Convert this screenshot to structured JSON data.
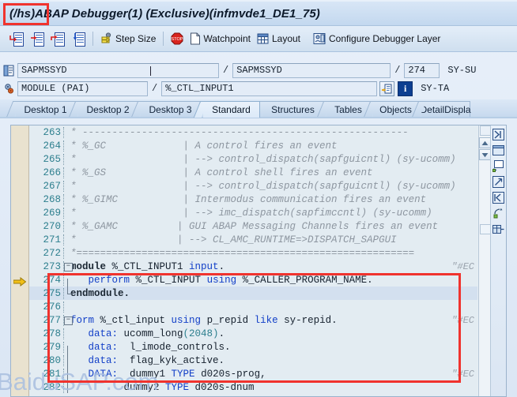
{
  "window": {
    "title": "(/hs)ABAP Debugger(1)  (Exclusive)(infmvde1_DE1_75)",
    "command_prefix": "(/hs)"
  },
  "toolbar": {
    "icons": [
      {
        "name": "step-into-icon",
        "tooltip": "Single Step"
      },
      {
        "name": "step-over-icon",
        "tooltip": "Execute"
      },
      {
        "name": "step-return-icon",
        "tooltip": "Return"
      },
      {
        "name": "continue-icon",
        "tooltip": "Continue"
      }
    ],
    "buttons": [
      {
        "name": "step-size-button",
        "label": "Step Size",
        "icon": "step-size-icon"
      },
      {
        "name": "watchpoint-button",
        "label": "Watchpoint",
        "icon": "watchpoint-icon"
      },
      {
        "name": "layout-button",
        "label": "Layout",
        "icon": "layout-icon"
      },
      {
        "name": "configure-debugger-layer-button",
        "label": "Configure Debugger Layer",
        "icon": "configure-icon"
      }
    ]
  },
  "fields": {
    "row1": {
      "icon": "program-icon",
      "main_program": "SAPMSSYD",
      "separator": "/",
      "include_program": "SAPMSSYD",
      "separator2": "/",
      "line_number": "274",
      "sy_field": "SY-SU"
    },
    "row2": {
      "icon": "event-icon",
      "event_type": "MODULE (PAI)",
      "separator": "/",
      "event_name": "%_CTL_INPUT1",
      "goto_button": "goto-icon",
      "info_button": "i",
      "sy_field": "SY-TA"
    }
  },
  "tabs": [
    {
      "label": "Desktop 1",
      "selected": false
    },
    {
      "label": "Desktop 2",
      "selected": false
    },
    {
      "label": "Desktop 3",
      "selected": false
    },
    {
      "label": "Standard",
      "selected": true
    },
    {
      "label": "Structures",
      "selected": false
    },
    {
      "label": "Tables",
      "selected": false
    },
    {
      "label": "Objects",
      "selected": false
    },
    {
      "label": "DetailDispla",
      "selected": false
    }
  ],
  "editor": {
    "current_line": 274,
    "lines": [
      {
        "n": "263",
        "segs": [
          {
            "t": "* -------------------------------------------------------",
            "c": "cmt"
          }
        ],
        "fold": "",
        "ec": ""
      },
      {
        "n": "264",
        "segs": [
          {
            "t": "* %_GC             | A control fires an event",
            "c": "cmt"
          }
        ],
        "fold": "",
        "ec": ""
      },
      {
        "n": "265",
        "segs": [
          {
            "t": "*                  | --> control_dispatch(sapfguicntl) (sy-ucomm)",
            "c": "cmt"
          }
        ],
        "fold": "",
        "ec": ""
      },
      {
        "n": "266",
        "segs": [
          {
            "t": "* %_GS             | A control shell fires an event",
            "c": "cmt"
          }
        ],
        "fold": "",
        "ec": ""
      },
      {
        "n": "267",
        "segs": [
          {
            "t": "*                  | --> control_dispatch(sapfguicntl) (sy-ucomm)",
            "c": "cmt"
          }
        ],
        "fold": "",
        "ec": ""
      },
      {
        "n": "268",
        "segs": [
          {
            "t": "* %_GIMC           | Intermodus communication fires an event",
            "c": "cmt"
          }
        ],
        "fold": "",
        "ec": ""
      },
      {
        "n": "269",
        "segs": [
          {
            "t": "*                  | --> imc_dispatch(sapfimccntl) (sy-ucomm)",
            "c": "cmt"
          }
        ],
        "fold": "",
        "ec": ""
      },
      {
        "n": "270",
        "segs": [
          {
            "t": "* %_GAMC          | GUI ABAP Messaging Channels fires an event",
            "c": "cmt"
          }
        ],
        "fold": "",
        "ec": ""
      },
      {
        "n": "271",
        "segs": [
          {
            "t": "*                 | --> CL_AMC_RUNTIME=>DISPATCH_SAPGUI",
            "c": "cmt"
          }
        ],
        "fold": "",
        "ec": ""
      },
      {
        "n": "272",
        "segs": [
          {
            "t": "*=========================================================",
            "c": "cmt"
          }
        ],
        "fold": "",
        "ec": ""
      },
      {
        "n": "273",
        "segs": [
          {
            "t": "module ",
            "c": "bold"
          },
          {
            "t": "%_CTL_INPUT1 ",
            "c": "plain"
          },
          {
            "t": "input",
            "c": "kw"
          },
          {
            "t": ".",
            "c": "plain"
          }
        ],
        "fold": "minus",
        "ec": "\"#EC"
      },
      {
        "n": "274",
        "segs": [
          {
            "t": "   ",
            "c": "plain"
          },
          {
            "t": "perform",
            "c": "kw"
          },
          {
            "t": " %_CTL_INPUT ",
            "c": "plain"
          },
          {
            "t": "using",
            "c": "kw"
          },
          {
            "t": " %_CALLER_PROGRAM_NAME.",
            "c": "plain"
          }
        ],
        "fold": "",
        "ec": ""
      },
      {
        "n": "275",
        "segs": [
          {
            "t": "endmodule.",
            "c": "bold"
          }
        ],
        "fold": "end",
        "ec": "",
        "hl": true
      },
      {
        "n": "276",
        "segs": [
          {
            "t": "",
            "c": "plain"
          }
        ],
        "fold": "",
        "ec": ""
      },
      {
        "n": "277",
        "segs": [
          {
            "t": "form",
            "c": "kw"
          },
          {
            "t": " %_ctl_input ",
            "c": "plain"
          },
          {
            "t": "using",
            "c": "kw"
          },
          {
            "t": " p_repid ",
            "c": "plain"
          },
          {
            "t": "like",
            "c": "kw"
          },
          {
            "t": " sy-repid.",
            "c": "plain"
          }
        ],
        "fold": "minus",
        "ec": "\"#EC"
      },
      {
        "n": "278",
        "segs": [
          {
            "t": "   ",
            "c": "plain"
          },
          {
            "t": "data:",
            "c": "kw"
          },
          {
            "t": " ucomm_long",
            "c": "plain"
          },
          {
            "t": "(2048)",
            "c": "num"
          },
          {
            "t": ".",
            "c": "plain"
          }
        ],
        "fold": "",
        "ec": ""
      },
      {
        "n": "279",
        "segs": [
          {
            "t": "   ",
            "c": "plain"
          },
          {
            "t": "data:",
            "c": "kw"
          },
          {
            "t": "  l_imode_controls.",
            "c": "plain"
          }
        ],
        "fold": "",
        "ec": ""
      },
      {
        "n": "280",
        "segs": [
          {
            "t": "   ",
            "c": "plain"
          },
          {
            "t": "data:",
            "c": "kw"
          },
          {
            "t": "  flag_kyk_active.",
            "c": "plain"
          }
        ],
        "fold": "",
        "ec": ""
      },
      {
        "n": "281",
        "segs": [
          {
            "t": "   ",
            "c": "plain"
          },
          {
            "t": "DATA:",
            "c": "kw"
          },
          {
            "t": "  dummy1 ",
            "c": "plain"
          },
          {
            "t": "TYPE",
            "c": "kw"
          },
          {
            "t": " d020s-prog,",
            "c": "plain"
          }
        ],
        "fold": "",
        "ec": "\"#EC"
      },
      {
        "n": "282",
        "segs": [
          {
            "t": "         dummy2 ",
            "c": "plain"
          },
          {
            "t": "TYPE",
            "c": "kw"
          },
          {
            "t": " d020s-dnum",
            "c": "plain"
          }
        ],
        "fold": "",
        "ec": ""
      }
    ]
  },
  "watermark": {
    "text": "BaiduSAP.com"
  },
  "colors": {
    "annotation": "#f0332e",
    "gutter": "#e9e2cf",
    "code_bg": "#e3ecf2",
    "comment": "#8d96a0",
    "keyword": "#1340c8",
    "line_number": "#2d7f8e",
    "watermark": "#a9bfe0"
  }
}
